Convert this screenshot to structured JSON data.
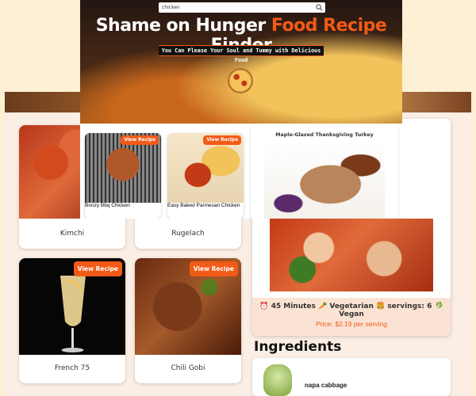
{
  "header": {
    "search_value": "chicken",
    "title_part1": "Shame on Hunger ",
    "title_accent": "Food Recipe",
    "title_part2": " Finder",
    "tagline": "You Can Please Your Soul and Tummy with Delicious Food"
  },
  "overlay_cards": [
    {
      "name": "Boozy Bbq Chicken",
      "button": "View Recipe"
    },
    {
      "name": "Easy Baked Parmesan Chicken",
      "button": "View Recipe"
    }
  ],
  "featured": {
    "title": "Maple-Glazed Thanksgiving Turkey"
  },
  "recipe_cards": [
    {
      "name": "Kimchi"
    },
    {
      "name": "Rugelach"
    },
    {
      "name": "French 75",
      "button": "View Recipe"
    },
    {
      "name": "Chili Gobi",
      "button": "View Recipe"
    }
  ],
  "detail": {
    "meta": "⏰ 45 Minutes 🥕 Vegetarian 🍔 servings: 6 🥬 Vegan",
    "price": "Price: $2.19 per serving",
    "ingredients_heading": "Ingredients",
    "ingredients": [
      {
        "name": "napa cabbage"
      }
    ]
  },
  "colors": {
    "accent": "#f25a17",
    "page_bg": "#fdf0d5"
  }
}
